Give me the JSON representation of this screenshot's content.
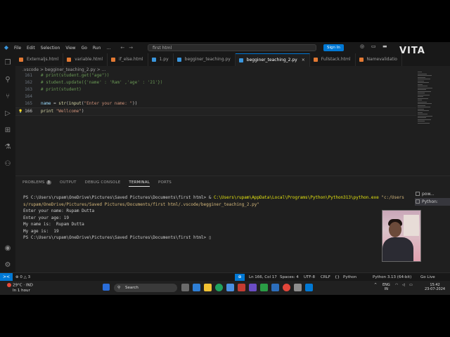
{
  "titlebar": {
    "menus": [
      "File",
      "Edit",
      "Selection",
      "View",
      "Go",
      "Run"
    ],
    "more": "…",
    "back": "←",
    "forward": "→",
    "search_text": "first html",
    "signin_label": "Sign In",
    "watermark": "VITA"
  },
  "tabs": [
    {
      "label": "Externaljs.html",
      "color": "#e37933"
    },
    {
      "label": "variable.html",
      "color": "#e37933"
    },
    {
      "label": "if_else.html",
      "color": "#e37933"
    },
    {
      "label": "1.py",
      "color": "#3a96dd"
    },
    {
      "label": "begginer_teaching.py",
      "color": "#3a96dd"
    },
    {
      "label": "begginer_teaching_2.py",
      "color": "#3a96dd",
      "active": true,
      "close": "×"
    },
    {
      "label": "Fullstack.html",
      "color": "#e37933"
    },
    {
      "label": "Namevalidatio",
      "color": "#e37933"
    }
  ],
  "breadcrumb": ".vscode  >  begginer_teaching_2.py  >  ...",
  "editor": {
    "lines": [
      {
        "num": "161",
        "segments": [
          {
            "t": "# print(student.get(\"age\"))",
            "c": "com"
          }
        ]
      },
      {
        "num": "162",
        "segments": [
          {
            "t": "# student.update({'name' : 'Ram' ,'age' : '21'})",
            "c": "com"
          }
        ]
      },
      {
        "num": "163",
        "segments": [
          {
            "t": "# print(student)",
            "c": "com"
          }
        ]
      },
      {
        "num": "164",
        "segments": [
          {
            "t": "",
            "c": ""
          }
        ]
      },
      {
        "num": "165",
        "segments": [
          {
            "t": "name",
            "c": "var"
          },
          {
            "t": " = ",
            "c": ""
          },
          {
            "t": "str",
            "c": "fn"
          },
          {
            "t": "(",
            "c": ""
          },
          {
            "t": "input",
            "c": "fn"
          },
          {
            "t": "(",
            "c": ""
          },
          {
            "t": "\"Enter your name: \"",
            "c": "str"
          },
          {
            "t": "))",
            "c": ""
          }
        ]
      },
      {
        "num": "166",
        "segments": [
          {
            "t": "print",
            "c": "fn"
          },
          {
            "t": " ",
            "c": ""
          },
          {
            "t": "\"Wellcome\"",
            "c": "str"
          },
          {
            "t": ")",
            "c": ""
          }
        ],
        "current": true
      }
    ]
  },
  "panel": {
    "tabs": [
      {
        "label": "PROBLEMS",
        "badge": "3"
      },
      {
        "label": "OUTPUT"
      },
      {
        "label": "DEBUG CONSOLE"
      },
      {
        "label": "TERMINAL",
        "active": true
      },
      {
        "label": "PORTS"
      }
    ],
    "terminal_lines": [
      [
        {
          "t": "PS C:\\Users\\rupam\\OneDrive\\Pictures\\Saved Pictures\\Documents\\first html> & ",
          "c": ""
        },
        {
          "t": "C:\\Users\\rupam\\AppData\\Local\\Programs\\Python\\Python313\\python.exe",
          "c": "yellow"
        },
        {
          "t": " \"c:/Users",
          "c": "str"
        }
      ],
      [
        {
          "t": "s/rupam/OneDrive/Pictures/Saved Pictures/Documents/first html/.vscode/begginer_teaching_2.py\"",
          "c": "str"
        }
      ],
      [
        {
          "t": "Enter your name: Rupam Dutta",
          "c": ""
        }
      ],
      [
        {
          "t": "Enter your age: 19",
          "c": ""
        }
      ],
      [
        {
          "t": "My name is:  Rupam Dutta",
          "c": ""
        }
      ],
      [
        {
          "t": "My age is:  19",
          "c": ""
        }
      ],
      [
        {
          "t": "PS C:\\Users\\rupam\\OneDrive\\Pictures\\Saved Pictures\\Documents\\first html> ",
          "c": ""
        }
      ]
    ],
    "terminal_list": [
      {
        "label": "pow...",
        "selected": false
      },
      {
        "label": "Python:",
        "selected": true
      }
    ]
  },
  "statusbar": {
    "errors": "⊗ 0 △ 3",
    "warnings": "⚠ 0",
    "position": "Ln 166, Col 17",
    "spaces": "Spaces: 4",
    "encoding": "UTF-8",
    "eol": "CRLF",
    "braces": "{}",
    "language": "Python",
    "interpreter": "Python 3.13 (64-bit)",
    "golive": "Go Live",
    "remote": "><"
  },
  "taskbar": {
    "temp": "29°C · IND",
    "weather_sub": "In 1 hour",
    "search": "Search",
    "lang1": "ENG",
    "lang2": "IN",
    "time": "15:42",
    "date": "23-07-2024"
  }
}
